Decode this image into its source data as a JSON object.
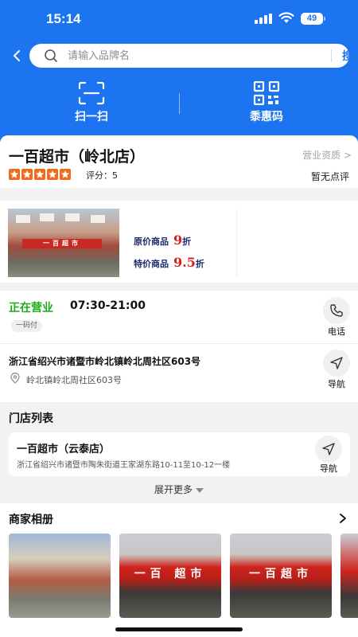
{
  "status_bar": {
    "time": "15:14",
    "battery": "49"
  },
  "search": {
    "placeholder": "请输入品牌名",
    "button_label": "搜索"
  },
  "quick_actions": [
    {
      "label": "扫一扫",
      "icon": "scan-icon"
    },
    {
      "label": "黍惠码",
      "icon": "qr-code-icon"
    }
  ],
  "store": {
    "name": "一百超市（岭北店）",
    "license_label": "营业资质 >",
    "rating_text": "评分：5",
    "rating": 5,
    "review_text": "暂无点评"
  },
  "banner": {
    "storefront_sign": "一百超市",
    "line1_label": "原价商品",
    "line1_value": "9",
    "line1_unit": "折",
    "line2_label": "特价商品",
    "line2_value": "9.5",
    "line2_unit": "折"
  },
  "hours": {
    "status": "正在营业",
    "time": "07:30-21:00",
    "payment_badge": "一码付",
    "phone_label": "电话",
    "address": "浙江省绍兴市诸暨市岭北镇岭北周社区603号",
    "address_detail": "岭北镇岭北周社区603号",
    "nav_label": "导航"
  },
  "store_list": {
    "title": "门店列表",
    "items": [
      {
        "name": "一百超市（云泰店）",
        "address": "浙江省绍兴市诸暨市陶朱街道王家湖东路10-11至10-12一楼",
        "nav_label": "导航"
      }
    ],
    "expand_label": "展开更多"
  },
  "album": {
    "title": "商家相册",
    "photo_signs": [
      "",
      "一百 超市",
      "一百超市",
      ""
    ]
  },
  "colors": {
    "brand_blue": "#1c74f0",
    "open_green": "#1aac19",
    "star_orange": "#f26a1b",
    "promo_red": "#d7211e"
  }
}
